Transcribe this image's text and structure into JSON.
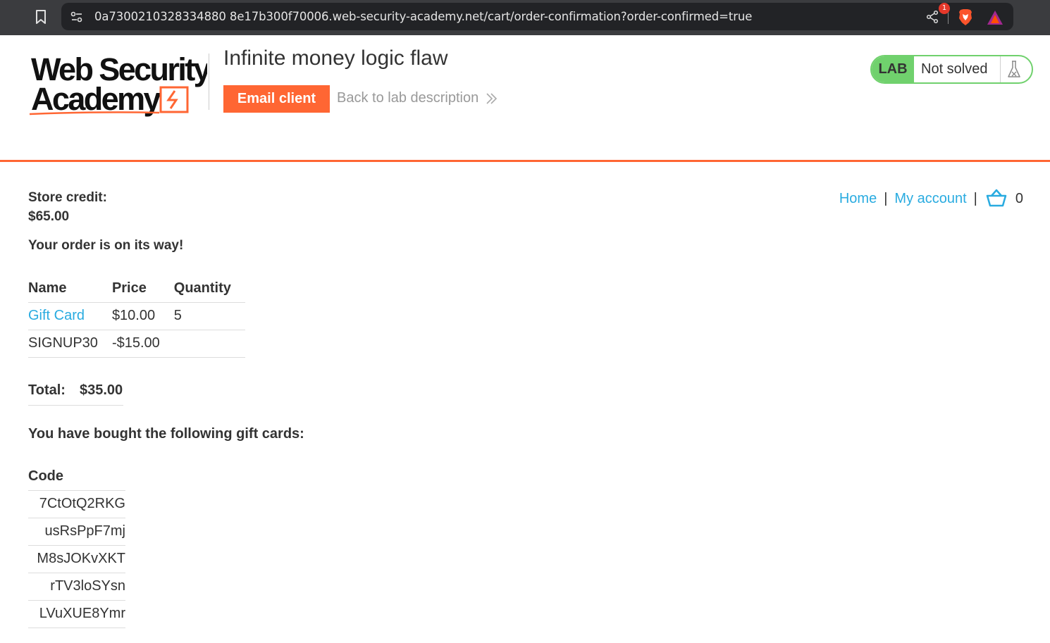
{
  "browser": {
    "url": "0a7300210328334880 8e17b300f70006.web-security-academy.net/cart/order-confirmation?order-confirmed=true",
    "notification_count": "1"
  },
  "lab": {
    "logo_line1": "Web Security",
    "logo_line2": "Academy",
    "title": "Infinite money logic flaw",
    "email_button": "Email client",
    "back_link": "Back to lab description",
    "status_tag": "LAB",
    "status_text": "Not solved"
  },
  "nav": {
    "home": "Home",
    "account": "My account",
    "separator": "|",
    "cart_count": "0"
  },
  "credit": {
    "label": "Store credit:",
    "value": "$65.00"
  },
  "order_message": "Your order is on its way!",
  "items_table": {
    "headers": [
      "Name",
      "Price",
      "Quantity"
    ],
    "rows": [
      {
        "name": "Gift Card",
        "price": "$10.00",
        "quantity": "5"
      },
      {
        "name": "SIGNUP30",
        "price": "-$15.00",
        "quantity": ""
      }
    ]
  },
  "total": {
    "label": "Total:",
    "value": "$35.00"
  },
  "gift_cards": {
    "message": "You have bought the following gift cards:",
    "header": "Code",
    "codes": [
      "7CtOtQ2RKG",
      "usRsPpF7mj",
      "M8sJOKvXKT",
      "rTV3loSYsn",
      "LVuXUE8Ymr"
    ]
  },
  "colors": {
    "accent_orange": "#ff6633",
    "link_blue": "#29abe0",
    "lab_green": "#70d16d"
  }
}
